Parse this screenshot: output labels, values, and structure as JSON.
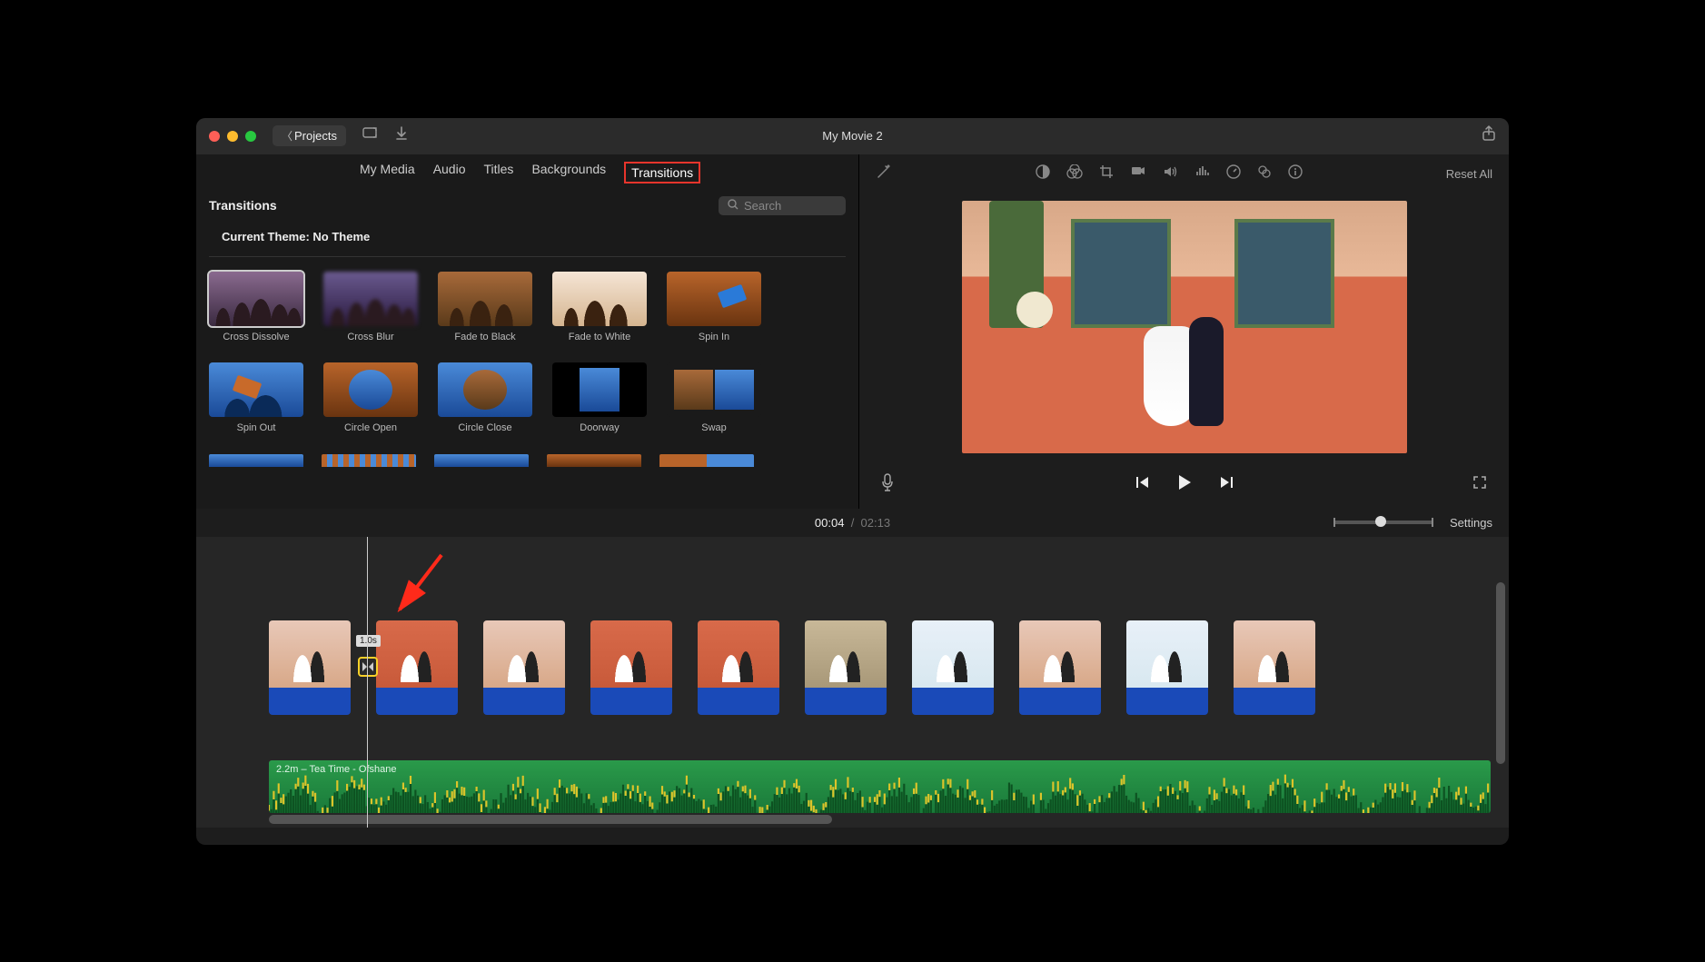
{
  "title": "My Movie 2",
  "back_label": "Projects",
  "tabs": {
    "my_media": "My Media",
    "audio": "Audio",
    "titles": "Titles",
    "backgrounds": "Backgrounds",
    "transitions": "Transitions"
  },
  "browser": {
    "section_title": "Transitions",
    "search_placeholder": "Search",
    "theme_label": "Current Theme: No Theme",
    "items": [
      {
        "label": "Cross Dissolve"
      },
      {
        "label": "Cross Blur"
      },
      {
        "label": "Fade to Black"
      },
      {
        "label": "Fade to White"
      },
      {
        "label": "Spin In"
      },
      {
        "label": "Spin Out"
      },
      {
        "label": "Circle Open"
      },
      {
        "label": "Circle Close"
      },
      {
        "label": "Doorway"
      },
      {
        "label": "Swap"
      }
    ]
  },
  "viewer": {
    "reset": "Reset All"
  },
  "timeline": {
    "current": "00:04",
    "duration": "02:13",
    "settings": "Settings",
    "transition_duration": "1.0s",
    "audio_clip": "2.2m – Tea Time - Ofshane"
  }
}
